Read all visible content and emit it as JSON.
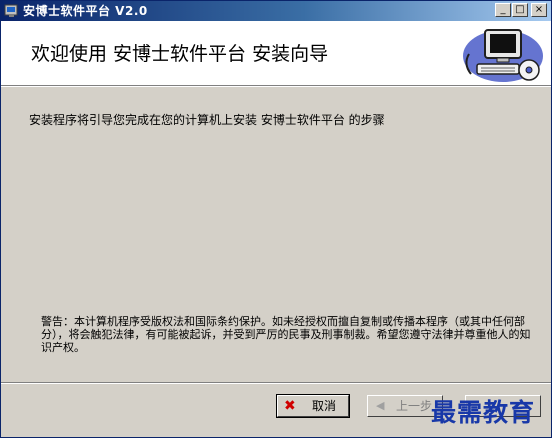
{
  "window": {
    "title": "安博士软件平台 V2.0",
    "controls": {
      "minimize": "_",
      "maximize": "□",
      "close": "×"
    }
  },
  "header": {
    "title": "欢迎使用  安博士软件平台  安装向导",
    "graphic_icon": "computer-with-cd-icon"
  },
  "body": {
    "intro": "安装程序将引导您完成在您的计算机上安装  安博士软件平台  的步骤",
    "warning": "警告：本计算机程序受版权法和国际条约保护。如未经授权而擅自复制或传播本程序（或其中任何部分），将会触犯法律，有可能被起诉，并受到严厉的民事及刑事制裁。希望您遵守法律并尊重他人的知识产权。"
  },
  "buttons": {
    "cancel": {
      "label": "取消",
      "icon": "red-x-icon"
    },
    "previous": {
      "label": "上一步",
      "icon": "left-arrow-icon",
      "enabled": false
    },
    "next": {
      "label": "下一步"
    }
  },
  "watermark": {
    "text": "最需教育"
  },
  "colors": {
    "titlebar_start": "#0a246a",
    "titlebar_end": "#a6caf0",
    "face": "#d4d0c8",
    "watermark": "#1838a8"
  }
}
